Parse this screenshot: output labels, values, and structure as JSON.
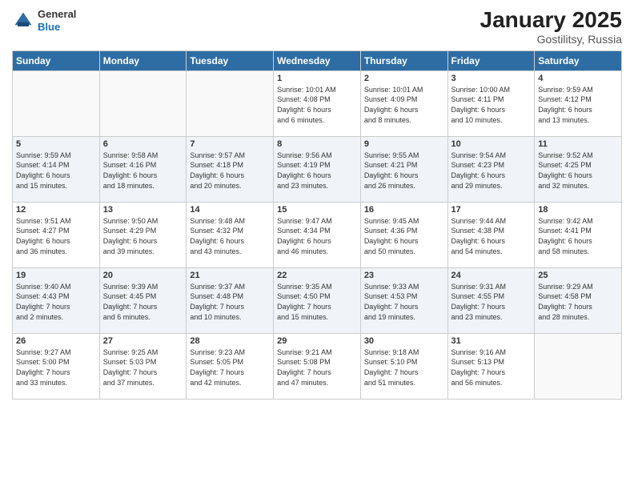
{
  "logo": {
    "general": "General",
    "blue": "Blue"
  },
  "title": "January 2025",
  "subtitle": "Gostilitsy, Russia",
  "days_header": [
    "Sunday",
    "Monday",
    "Tuesday",
    "Wednesday",
    "Thursday",
    "Friday",
    "Saturday"
  ],
  "weeks": [
    [
      {
        "day": "",
        "info": ""
      },
      {
        "day": "",
        "info": ""
      },
      {
        "day": "",
        "info": ""
      },
      {
        "day": "1",
        "info": "Sunrise: 10:01 AM\nSunset: 4:08 PM\nDaylight: 6 hours\nand 6 minutes."
      },
      {
        "day": "2",
        "info": "Sunrise: 10:01 AM\nSunset: 4:09 PM\nDaylight: 6 hours\nand 8 minutes."
      },
      {
        "day": "3",
        "info": "Sunrise: 10:00 AM\nSunset: 4:11 PM\nDaylight: 6 hours\nand 10 minutes."
      },
      {
        "day": "4",
        "info": "Sunrise: 9:59 AM\nSunset: 4:12 PM\nDaylight: 6 hours\nand 13 minutes."
      }
    ],
    [
      {
        "day": "5",
        "info": "Sunrise: 9:59 AM\nSunset: 4:14 PM\nDaylight: 6 hours\nand 15 minutes."
      },
      {
        "day": "6",
        "info": "Sunrise: 9:58 AM\nSunset: 4:16 PM\nDaylight: 6 hours\nand 18 minutes."
      },
      {
        "day": "7",
        "info": "Sunrise: 9:57 AM\nSunset: 4:18 PM\nDaylight: 6 hours\nand 20 minutes."
      },
      {
        "day": "8",
        "info": "Sunrise: 9:56 AM\nSunset: 4:19 PM\nDaylight: 6 hours\nand 23 minutes."
      },
      {
        "day": "9",
        "info": "Sunrise: 9:55 AM\nSunset: 4:21 PM\nDaylight: 6 hours\nand 26 minutes."
      },
      {
        "day": "10",
        "info": "Sunrise: 9:54 AM\nSunset: 4:23 PM\nDaylight: 6 hours\nand 29 minutes."
      },
      {
        "day": "11",
        "info": "Sunrise: 9:52 AM\nSunset: 4:25 PM\nDaylight: 6 hours\nand 32 minutes."
      }
    ],
    [
      {
        "day": "12",
        "info": "Sunrise: 9:51 AM\nSunset: 4:27 PM\nDaylight: 6 hours\nand 36 minutes."
      },
      {
        "day": "13",
        "info": "Sunrise: 9:50 AM\nSunset: 4:29 PM\nDaylight: 6 hours\nand 39 minutes."
      },
      {
        "day": "14",
        "info": "Sunrise: 9:48 AM\nSunset: 4:32 PM\nDaylight: 6 hours\nand 43 minutes."
      },
      {
        "day": "15",
        "info": "Sunrise: 9:47 AM\nSunset: 4:34 PM\nDaylight: 6 hours\nand 46 minutes."
      },
      {
        "day": "16",
        "info": "Sunrise: 9:45 AM\nSunset: 4:36 PM\nDaylight: 6 hours\nand 50 minutes."
      },
      {
        "day": "17",
        "info": "Sunrise: 9:44 AM\nSunset: 4:38 PM\nDaylight: 6 hours\nand 54 minutes."
      },
      {
        "day": "18",
        "info": "Sunrise: 9:42 AM\nSunset: 4:41 PM\nDaylight: 6 hours\nand 58 minutes."
      }
    ],
    [
      {
        "day": "19",
        "info": "Sunrise: 9:40 AM\nSunset: 4:43 PM\nDaylight: 7 hours\nand 2 minutes."
      },
      {
        "day": "20",
        "info": "Sunrise: 9:39 AM\nSunset: 4:45 PM\nDaylight: 7 hours\nand 6 minutes."
      },
      {
        "day": "21",
        "info": "Sunrise: 9:37 AM\nSunset: 4:48 PM\nDaylight: 7 hours\nand 10 minutes."
      },
      {
        "day": "22",
        "info": "Sunrise: 9:35 AM\nSunset: 4:50 PM\nDaylight: 7 hours\nand 15 minutes."
      },
      {
        "day": "23",
        "info": "Sunrise: 9:33 AM\nSunset: 4:53 PM\nDaylight: 7 hours\nand 19 minutes."
      },
      {
        "day": "24",
        "info": "Sunrise: 9:31 AM\nSunset: 4:55 PM\nDaylight: 7 hours\nand 23 minutes."
      },
      {
        "day": "25",
        "info": "Sunrise: 9:29 AM\nSunset: 4:58 PM\nDaylight: 7 hours\nand 28 minutes."
      }
    ],
    [
      {
        "day": "26",
        "info": "Sunrise: 9:27 AM\nSunset: 5:00 PM\nDaylight: 7 hours\nand 33 minutes."
      },
      {
        "day": "27",
        "info": "Sunrise: 9:25 AM\nSunset: 5:03 PM\nDaylight: 7 hours\nand 37 minutes."
      },
      {
        "day": "28",
        "info": "Sunrise: 9:23 AM\nSunset: 5:05 PM\nDaylight: 7 hours\nand 42 minutes."
      },
      {
        "day": "29",
        "info": "Sunrise: 9:21 AM\nSunset: 5:08 PM\nDaylight: 7 hours\nand 47 minutes."
      },
      {
        "day": "30",
        "info": "Sunrise: 9:18 AM\nSunset: 5:10 PM\nDaylight: 7 hours\nand 51 minutes."
      },
      {
        "day": "31",
        "info": "Sunrise: 9:16 AM\nSunset: 5:13 PM\nDaylight: 7 hours\nand 56 minutes."
      },
      {
        "day": "",
        "info": ""
      }
    ]
  ]
}
